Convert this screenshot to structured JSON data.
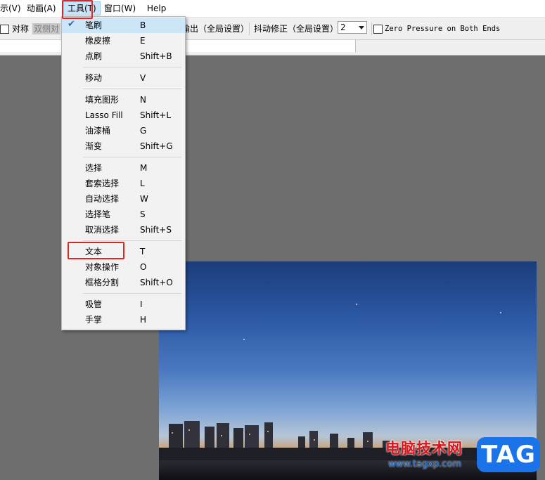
{
  "menubar": {
    "items": [
      {
        "label": "示(V)"
      },
      {
        "label": "动画(A)"
      },
      {
        "label": "工具(T)"
      },
      {
        "label": "窗口(W)"
      },
      {
        "label": "Help"
      }
    ]
  },
  "toolbar": {
    "symmetry_label": "对称",
    "dual_side_label": "双侧对",
    "output_label": "输出（全局设置）",
    "stabilizer_label": "抖动修正（全局设置）",
    "stabilizer_value": "2",
    "zero_pressure_label": "Zero Pressure on Both Ends"
  },
  "tools_menu": {
    "groups": [
      [
        {
          "label": "笔刷",
          "shortcut": "B",
          "checked": true
        },
        {
          "label": "橡皮擦",
          "shortcut": "E"
        },
        {
          "label": "点刷",
          "shortcut": "Shift+B"
        }
      ],
      [
        {
          "label": "移动",
          "shortcut": "V"
        }
      ],
      [
        {
          "label": "填充图形",
          "shortcut": "N"
        },
        {
          "label": "Lasso Fill",
          "shortcut": "Shift+L"
        },
        {
          "label": "油漆桶",
          "shortcut": "G"
        },
        {
          "label": "渐变",
          "shortcut": "Shift+G"
        }
      ],
      [
        {
          "label": "选择",
          "shortcut": "M"
        },
        {
          "label": "套索选择",
          "shortcut": "L"
        },
        {
          "label": "自动选择",
          "shortcut": "W"
        },
        {
          "label": "选择笔",
          "shortcut": "S"
        },
        {
          "label": "取消选择",
          "shortcut": "Shift+S"
        }
      ],
      [
        {
          "label": "文本",
          "shortcut": "T"
        },
        {
          "label": "对象操作",
          "shortcut": "O"
        },
        {
          "label": "框格分割",
          "shortcut": "Shift+O"
        }
      ],
      [
        {
          "label": "吸管",
          "shortcut": "I"
        },
        {
          "label": "手掌",
          "shortcut": "H"
        }
      ]
    ]
  },
  "watermark": {
    "site_name": "电脑技术网",
    "url": "www.tagxp.com",
    "logo_text": "TAG"
  },
  "colors": {
    "highlight_box": "#e12525",
    "menu_hover": "#cde6f7",
    "canvas_bg": "#6e6e6e"
  }
}
